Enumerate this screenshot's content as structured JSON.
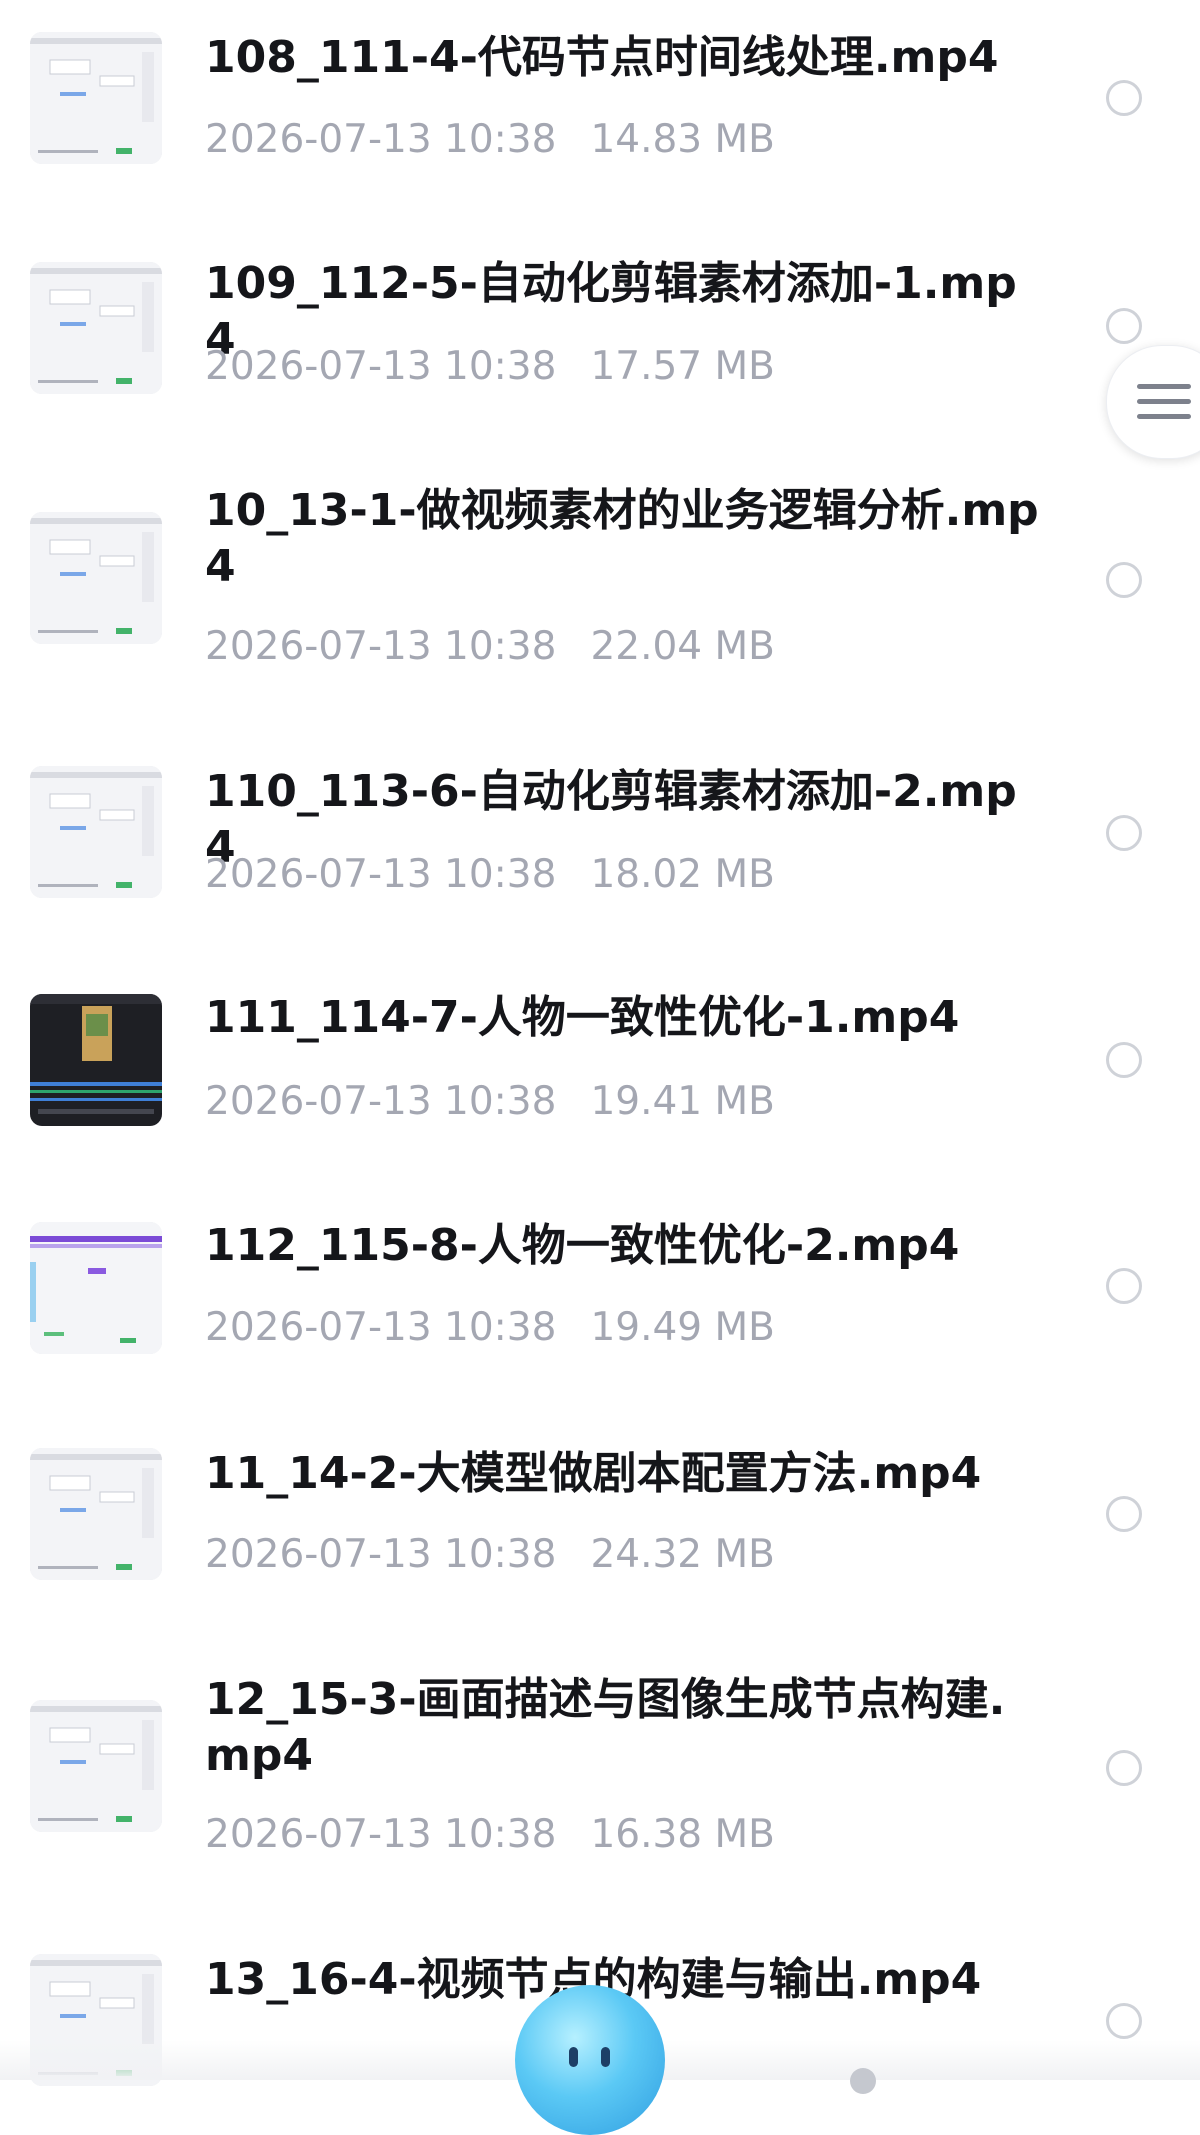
{
  "files": [
    {
      "name": "108_111-4-代码节点时间线处理.mp4",
      "date": "2026-07-13 10:38",
      "size": "14.83 MB",
      "thumb": "light"
    },
    {
      "name": "109_112-5-自动化剪辑素材添加-1.mp4",
      "date": "2026-07-13 10:38",
      "size": "17.57 MB",
      "thumb": "light"
    },
    {
      "name": "10_13-1-做视频素材的业务逻辑分析.mp4",
      "date": "2026-07-13 10:38",
      "size": "22.04 MB",
      "thumb": "light"
    },
    {
      "name": "110_113-6-自动化剪辑素材添加-2.mp4",
      "date": "2026-07-13 10:38",
      "size": "18.02 MB",
      "thumb": "light"
    },
    {
      "name": "111_114-7-人物一致性优化-1.mp4",
      "date": "2026-07-13 10:38",
      "size": "19.41 MB",
      "thumb": "dark"
    },
    {
      "name": "112_115-8-人物一致性优化-2.mp4",
      "date": "2026-07-13 10:38",
      "size": "19.49 MB",
      "thumb": "purple"
    },
    {
      "name": "11_14-2-大模型做剧本配置方法.mp4",
      "date": "2026-07-13 10:38",
      "size": "24.32 MB",
      "thumb": "light"
    },
    {
      "name": "12_15-3-画面描述与图像生成节点构建.mp4",
      "date": "2026-07-13 10:38",
      "size": "16.38 MB",
      "thumb": "light"
    },
    {
      "name": "13_16-4-视频节点的构建与输出.mp4",
      "date": "",
      "size": "",
      "thumb": "light"
    }
  ],
  "colors": {
    "title": "#15161a",
    "meta": "#a4a7b2",
    "radio_border": "#cfd2d8",
    "accent": "#2f9de0"
  },
  "icons": {
    "side_handle": "menu-lines-icon",
    "assistant": "assistant-bubble-icon"
  }
}
